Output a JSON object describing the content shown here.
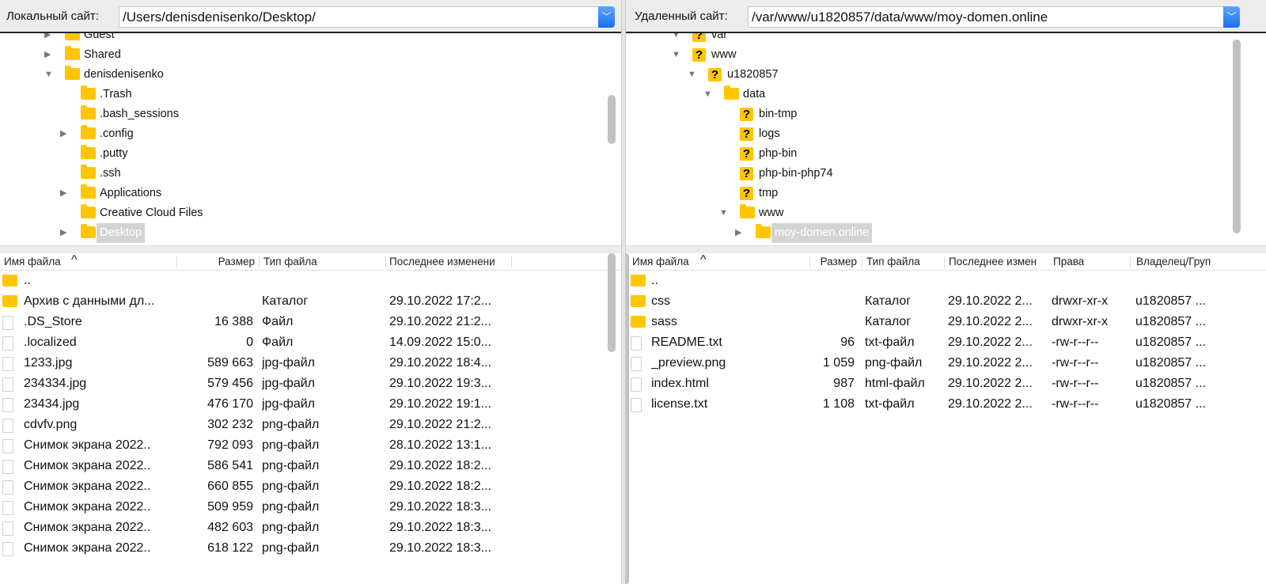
{
  "local": {
    "label": "Локальный сайт:",
    "path": "/Users/denisdenisenko/Desktop/",
    "tree": [
      {
        "name": "Guest",
        "depth": 0,
        "arrow": "collapsed",
        "icon": "folder"
      },
      {
        "name": "Shared",
        "depth": 0,
        "arrow": "collapsed",
        "icon": "folder"
      },
      {
        "name": "denisdenisenko",
        "depth": 0,
        "arrow": "expanded",
        "icon": "folder"
      },
      {
        "name": ".Trash",
        "depth": 1,
        "arrow": "none",
        "icon": "folder"
      },
      {
        "name": ".bash_sessions",
        "depth": 1,
        "arrow": "none",
        "icon": "folder"
      },
      {
        "name": ".config",
        "depth": 1,
        "arrow": "collapsed",
        "icon": "folder"
      },
      {
        "name": ".putty",
        "depth": 1,
        "arrow": "none",
        "icon": "folder"
      },
      {
        "name": ".ssh",
        "depth": 1,
        "arrow": "none",
        "icon": "folder"
      },
      {
        "name": "Applications",
        "depth": 1,
        "arrow": "collapsed",
        "icon": "folder"
      },
      {
        "name": "Creative Cloud Files",
        "depth": 1,
        "arrow": "none",
        "icon": "folder"
      },
      {
        "name": "Desktop",
        "depth": 1,
        "arrow": "collapsed",
        "icon": "folder",
        "selected": true
      }
    ],
    "columns": [
      "Имя файла",
      "Размер",
      "Тип файла",
      "Последнее изменени"
    ],
    "files": [
      {
        "name": "..",
        "size": "",
        "type": "",
        "modified": "",
        "icon": "folder"
      },
      {
        "name": "Архив с данными дл...",
        "size": "",
        "type": "Каталог",
        "modified": "29.10.2022 17:2...",
        "icon": "folder"
      },
      {
        "name": ".DS_Store",
        "size": "16 388",
        "type": "Файл",
        "modified": "29.10.2022 21:2...",
        "icon": "file"
      },
      {
        "name": ".localized",
        "size": "0",
        "type": "Файл",
        "modified": "14.09.2022 15:0...",
        "icon": "file"
      },
      {
        "name": "1233.jpg",
        "size": "589 663",
        "type": "jpg-файл",
        "modified": "29.10.2022 18:4...",
        "icon": "file"
      },
      {
        "name": "234334.jpg",
        "size": "579 456",
        "type": "jpg-файл",
        "modified": "29.10.2022 19:3...",
        "icon": "file"
      },
      {
        "name": "23434.jpg",
        "size": "476 170",
        "type": "jpg-файл",
        "modified": "29.10.2022 19:1...",
        "icon": "file"
      },
      {
        "name": "cdvfv.png",
        "size": "302 232",
        "type": "png-файл",
        "modified": "29.10.2022 21:2...",
        "icon": "file"
      },
      {
        "name": "Снимок экрана 2022..",
        "size": "792 093",
        "type": "png-файл",
        "modified": "28.10.2022 13:1...",
        "icon": "file"
      },
      {
        "name": "Снимок экрана 2022..",
        "size": "586 541",
        "type": "png-файл",
        "modified": "29.10.2022 18:2...",
        "icon": "file"
      },
      {
        "name": "Снимок экрана 2022..",
        "size": "660 855",
        "type": "png-файл",
        "modified": "29.10.2022 18:2...",
        "icon": "file"
      },
      {
        "name": "Снимок экрана 2022..",
        "size": "509 959",
        "type": "png-файл",
        "modified": "29.10.2022 18:3...",
        "icon": "file"
      },
      {
        "name": "Снимок экрана 2022..",
        "size": "482 603",
        "type": "png-файл",
        "modified": "29.10.2022 18:3...",
        "icon": "file"
      },
      {
        "name": "Снимок экрана 2022..",
        "size": "618 122",
        "type": "png-файл",
        "modified": "29.10.2022 18:3...",
        "icon": "file"
      }
    ]
  },
  "remote": {
    "label": "Удаленный сайт:",
    "path": "/var/www/u1820857/data/www/moy-domen.online",
    "tree": [
      {
        "name": "var",
        "depth": 0,
        "arrow": "expanded",
        "icon": "question"
      },
      {
        "name": "www",
        "depth": 0,
        "arrow": "expanded",
        "icon": "question"
      },
      {
        "name": "u1820857",
        "depth": 1,
        "arrow": "expanded",
        "icon": "question"
      },
      {
        "name": "data",
        "depth": 2,
        "arrow": "expanded",
        "icon": "folder"
      },
      {
        "name": "bin-tmp",
        "depth": 3,
        "arrow": "none",
        "icon": "question"
      },
      {
        "name": "logs",
        "depth": 3,
        "arrow": "none",
        "icon": "question"
      },
      {
        "name": "php-bin",
        "depth": 3,
        "arrow": "none",
        "icon": "question"
      },
      {
        "name": "php-bin-php74",
        "depth": 3,
        "arrow": "none",
        "icon": "question"
      },
      {
        "name": "tmp",
        "depth": 3,
        "arrow": "none",
        "icon": "question"
      },
      {
        "name": "www",
        "depth": 3,
        "arrow": "expanded",
        "icon": "folder"
      },
      {
        "name": "moy-domen.online",
        "depth": 4,
        "arrow": "collapsed",
        "icon": "folder",
        "selected": true
      }
    ],
    "columns": [
      "Имя файла",
      "Размер",
      "Тип файла",
      "Последнее измен",
      "Права",
      "Владелец/Груп"
    ],
    "files": [
      {
        "name": "..",
        "size": "",
        "type": "",
        "modified": "",
        "perms": "",
        "owner": "",
        "icon": "folder"
      },
      {
        "name": "css",
        "size": "",
        "type": "Каталог",
        "modified": "29.10.2022 2...",
        "perms": "drwxr-xr-x",
        "owner": "u1820857 ...",
        "icon": "folder"
      },
      {
        "name": "sass",
        "size": "",
        "type": "Каталог",
        "modified": "29.10.2022 2...",
        "perms": "drwxr-xr-x",
        "owner": "u1820857 ...",
        "icon": "folder"
      },
      {
        "name": "README.txt",
        "size": "96",
        "type": "txt-файл",
        "modified": "29.10.2022 2...",
        "perms": "-rw-r--r--",
        "owner": "u1820857 ...",
        "icon": "file"
      },
      {
        "name": "_preview.png",
        "size": "1 059",
        "type": "png-файл",
        "modified": "29.10.2022 2...",
        "perms": "-rw-r--r--",
        "owner": "u1820857 ...",
        "icon": "file"
      },
      {
        "name": "index.html",
        "size": "987",
        "type": "html-файл",
        "modified": "29.10.2022 2...",
        "perms": "-rw-r--r--",
        "owner": "u1820857 ...",
        "icon": "file"
      },
      {
        "name": "license.txt",
        "size": "1 108",
        "type": "txt-файл",
        "modified": "29.10.2022 2...",
        "perms": "-rw-r--r--",
        "owner": "u1820857 ...",
        "icon": "file"
      }
    ]
  },
  "sort_indicator": "^"
}
